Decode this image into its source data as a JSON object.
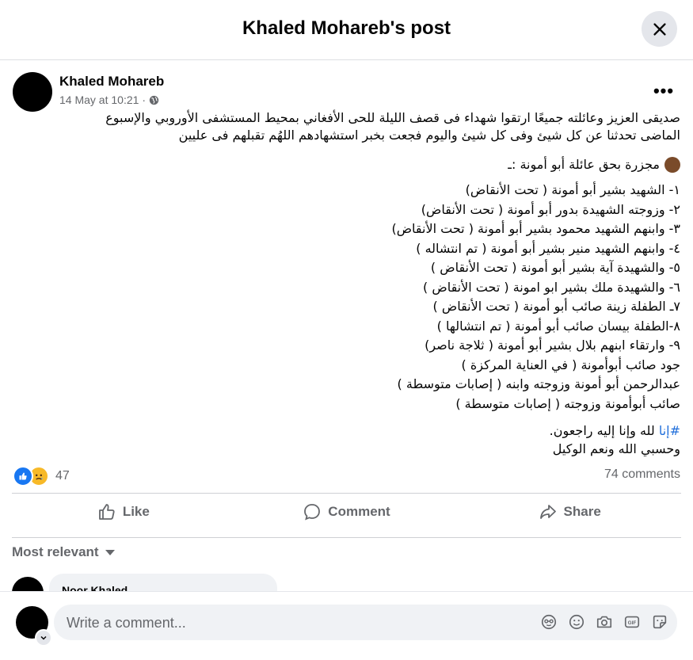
{
  "dialog": {
    "title": "Khaled Mohareb's post"
  },
  "post": {
    "author": "Khaled Mohareb",
    "timestamp": "14 May at 10:21",
    "separator": "·",
    "intro_line1": "صديقى العزيز وعائلته جميعًا ارتقوا شهداء فى قصف الليلة للحى الأفغاني بمحيط المستشفى الأوروبي والإسبوع",
    "intro_line2": "الماضى تحدثنا عن كل شيئ وفى كل شيئ واليوم فجعت بخبر استشهادهم اللهُم تقبلهم فى عليين",
    "heading": "مجزرة بحق عائلة أبو أمونة :ـ",
    "list": [
      "١- الشهيد بشير  أبو أمونة ( تحت الأنقاض)",
      "٢- وزوجته الشهيدة بدور أبو أمونة ( تحت الأنقاض)",
      "٣- وابنهم الشهيد محمود بشير أبو أمونة ( تحت الأنقاض)",
      "٤- وابنهم الشهيد منير بشير أبو أمونة ( تم انتشاله )",
      "٥- والشهيدة آية  بشير أبو أمونة ( تحت الأنقاض )",
      "٦- والشهيدة ملك بشير ابو امونة ( تحت الأنقاض )",
      "٧ـ الطفلة زينة صائب أبو أمونة ( تحت الأنقاض )",
      "٨-الطفلة بيسان صائب أبو أمونة ( تم انتشالها )",
      "٩- وارتقاء ابنهم بلال بشير أبو أمونة ( ثلاجة ناصر)",
      "جود صائب أبوأمونة ( في العناية المركزة )",
      "عبدالرحمن أبو أمونة وزوجته وابنه ( إصابات متوسطة )",
      "صائب أبوأمونة وزوجته ( إصابات متوسطة )"
    ],
    "hashtag": "#إنا",
    "closing_line1_rest": " لله وإنا إليه راجعون.",
    "closing_line2": "وحسبي الله ونعم الوكيل",
    "reaction_count": "47",
    "comments_count": "74 comments"
  },
  "actions": {
    "like": "Like",
    "comment": "Comment",
    "share": "Share"
  },
  "comments": {
    "sort_label": "Most relevant",
    "first_commenter": "Noor Khaled"
  },
  "composer": {
    "placeholder": "Write a comment..."
  },
  "colors": {
    "link": "#216fdb",
    "like_blue": "#1877f2",
    "sad_yellow": "#f7b928",
    "muted": "#65676b"
  }
}
